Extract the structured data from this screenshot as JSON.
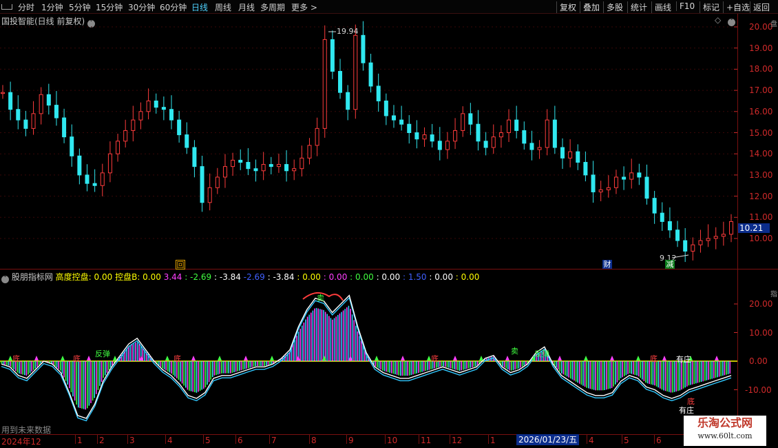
{
  "toolbar": {
    "periods": [
      "分时",
      "1分钟",
      "5分钟",
      "15分钟",
      "30分钟",
      "60分钟",
      "日线",
      "周线",
      "月线",
      "多周期",
      "更多 >"
    ],
    "active_period": "日线",
    "right_buttons": [
      "复权",
      "叠加",
      "多股",
      "统计",
      "画线",
      "F10",
      "标记",
      "+自选",
      "返回"
    ]
  },
  "main_chart": {
    "title": "国投智能(日线 前复权)",
    "y_ticks": [
      "20.00",
      "19.00",
      "18.00",
      "17.00",
      "16.00",
      "15.00",
      "14.00",
      "13.00",
      "12.00",
      "11.00",
      "10.00"
    ],
    "high_label": "19.94",
    "low_label": "9.12",
    "current_price": "10.21",
    "markers": {
      "hui": "回",
      "cai": "财",
      "jian": "减"
    }
  },
  "indicator": {
    "name": "股朋指标网",
    "values": [
      {
        "label": "高度控盘:",
        "value": "0.00"
      },
      {
        "label": "控盘B:",
        "value": "0.00"
      },
      {
        "label": "",
        "value": "3.44"
      },
      {
        "label": ":",
        "value": "-2.69"
      },
      {
        "label": ":",
        "value": "-3.84"
      },
      {
        "label": "",
        "value": "-2.69"
      },
      {
        "label": ":",
        "value": "-3.84"
      },
      {
        "label": ":",
        "value": "0.00"
      },
      {
        "label": ":",
        "value": "0.00"
      },
      {
        "label": ":",
        "value": "0.00"
      },
      {
        "label": ":",
        "value": "0.00"
      },
      {
        "label": ":",
        "value": "1.50"
      },
      {
        "label": ":",
        "value": "0.00"
      },
      {
        "label": ":",
        "value": "0.00"
      }
    ],
    "y_ticks": [
      "20.00",
      "10.00",
      "0.00",
      "-10.00"
    ],
    "annotations": {
      "sell": "卖",
      "rebound": "反弹",
      "has_zhuang": "有庄",
      "bottom": "底"
    },
    "footer_note": "用到未来数据"
  },
  "x_axis": {
    "labels": [
      "2024年12",
      "1",
      "2",
      "3",
      "4",
      "5",
      "6",
      "7",
      "8",
      "9",
      "10",
      "11",
      "12",
      "1",
      "2",
      "4",
      "5",
      "6"
    ],
    "current_date": "2026/01/23/五"
  },
  "watermark": {
    "line1": "乐淘公式网",
    "line2": "www.60lt.com"
  },
  "colors": {
    "up": "#ff3c3c",
    "down": "#30e8f0",
    "grid": "#7a1010",
    "magenta": "#ff40ff",
    "green": "#40ff40",
    "yellow": "#ffff00"
  },
  "chart_data": {
    "type": "candlestick",
    "price_series": [
      16.9,
      16.1,
      15.6,
      15.2,
      15.9,
      16.8,
      16.3,
      15.7,
      14.8,
      13.9,
      13.0,
      12.6,
      12.5,
      13.1,
      14.0,
      14.6,
      15.1,
      15.6,
      16.0,
      16.5,
      16.2,
      16.1,
      15.6,
      14.9,
      14.3,
      13.4,
      11.7,
      12.4,
      12.9,
      13.4,
      13.7,
      13.6,
      13.3,
      13.2,
      13.5,
      13.4,
      13.5,
      13.2,
      13.3,
      13.8,
      14.4,
      15.2,
      19.4,
      17.9,
      16.9,
      16.1,
      19.6,
      18.3,
      17.2,
      16.5,
      15.8,
      15.6,
      15.4,
      15.0,
      14.7,
      14.9,
      14.6,
      14.2,
      14.6,
      15.1,
      15.9,
      15.4,
      14.6,
      14.3,
      14.8,
      15.0,
      15.6,
      15.1,
      14.5,
      14.2,
      14.3,
      15.6,
      14.3,
      13.8,
      14.1,
      13.6,
      13.0,
      12.2,
      12.3,
      12.4,
      12.9,
      12.8,
      13.1,
      12.9,
      11.9,
      11.2,
      10.8,
      10.4,
      9.9,
      9.4,
      9.7,
      9.9,
      10.0,
      10.1,
      10.2,
      10.8
    ],
    "indicator_line": [
      -1,
      -2,
      -5,
      -6,
      -3,
      0,
      -1,
      -4,
      -11,
      -19,
      -20,
      -15,
      -7,
      -2,
      2,
      6,
      8,
      4,
      0,
      -3,
      -5,
      -8,
      -12,
      -13,
      -11,
      -6,
      -5,
      -5,
      -4,
      -3,
      -2,
      -2,
      -1,
      1,
      4,
      12,
      18,
      22,
      21,
      17,
      20,
      23,
      12,
      3,
      -2,
      -4,
      -5,
      -6,
      -6,
      -5,
      -4,
      -3,
      -2,
      -3,
      -4,
      -3,
      -2,
      1,
      2,
      -2,
      -4,
      -3,
      -1,
      3,
      5,
      -1,
      -5,
      -7,
      -9,
      -11,
      -12,
      -12,
      -11,
      -7,
      -5,
      -6,
      -9,
      -10,
      -12,
      -13,
      -12,
      -10,
      -9,
      -8,
      -7,
      -6,
      -5
    ]
  }
}
